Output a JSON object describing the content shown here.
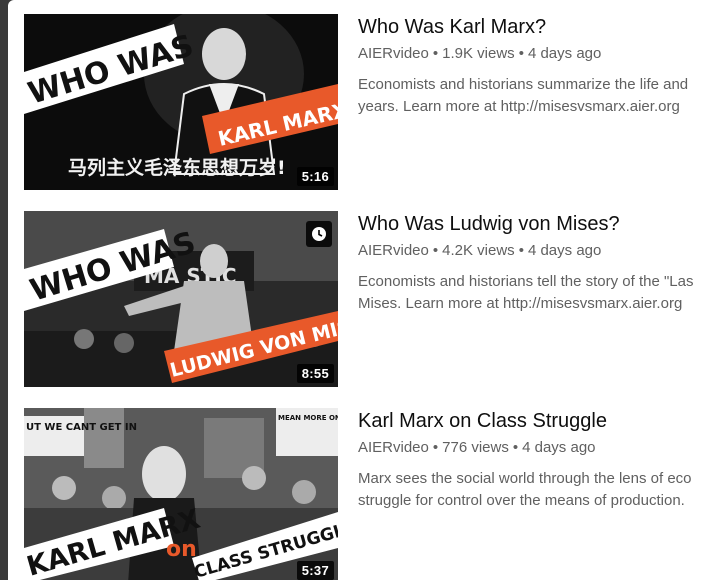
{
  "videos": [
    {
      "title": "Who Was Karl Marx?",
      "channel": "AIERvideo",
      "views": "1.9K views",
      "age": "4 days ago",
      "description_line1": "Economists and historians summarize the life and",
      "description_line2": "years. Learn more at http://misesvsmarx.aier.org",
      "duration": "5:16",
      "thumb_text_main": "WHO WAS",
      "thumb_text_banner": "KARL MARX?",
      "thumb_text_caption": "马列主义毛泽东思想万岁!"
    },
    {
      "title": "Who Was Ludwig von Mises?",
      "channel": "AIERvideo",
      "views": "4.2K views",
      "age": "4 days ago",
      "description_line1": "Economists and historians tell the story of the \"Las",
      "description_line2": "Mises. Learn more at http://misesvsmarx.aier.org",
      "duration": "8:55",
      "thumb_text_main": "WHO WAS",
      "thumb_text_banner": "LUDWIG VON MISES?",
      "thumb_text_marquee": "MA   STIC"
    },
    {
      "title": "Karl Marx on Class Struggle",
      "channel": "AIERvideo",
      "views": "776 views",
      "age": "4 days ago",
      "description_line1": "Marx sees the social world through the lens of eco",
      "description_line2": "struggle for control over the means of production.",
      "duration": "5:37",
      "thumb_text_main": "KARL MARX",
      "thumb_text_on": "on",
      "thumb_text_banner": "CLASS STRUGGLE",
      "thumb_sign_left": "UT WE CANT GET IN",
      "thumb_sign_right": "MEAN MORE ON RELIEF, HALF AS MANY ON THE JOB"
    }
  ],
  "separator": "•",
  "icons": {
    "watch_later": "clock-icon"
  },
  "colors": {
    "banner_orange": "#e8592a",
    "title_text": "#0f0f0f",
    "meta_text": "#606060"
  }
}
